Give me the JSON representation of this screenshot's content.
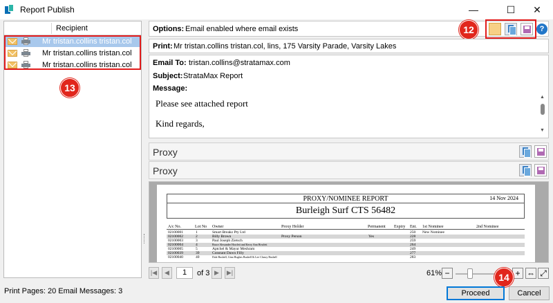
{
  "window": {
    "title": "Report Publish",
    "controls": {
      "minimize": "—",
      "maximize": "☐",
      "close": "✕"
    }
  },
  "recipients": {
    "column_header": "Recipient",
    "rows": [
      {
        "name": "Mr tristan.collins tristan.col",
        "selected": true
      },
      {
        "name": "Mr tristan.collins tristan.col",
        "selected": false
      },
      {
        "name": "Mr tristan.collins tristan.col",
        "selected": false
      }
    ]
  },
  "annotations": {
    "badge_12": "12",
    "badge_13": "13",
    "badge_14": "14"
  },
  "options": {
    "label": "Options:",
    "value": "Email enabled where email exists"
  },
  "print": {
    "label": "Print:",
    "value": "Mr tristan.collins tristan.col, lins, 175 Varsity Parade, Varsity Lakes"
  },
  "email": {
    "to_label": "Email To:",
    "to_value": "tristan.collins@stratamax.com",
    "subject_label": "Subject:",
    "subject_value": "StrataMax Report",
    "message_label": "Message:",
    "message_line1": "Please see attached report",
    "message_line2": "Kind regards,"
  },
  "proxy_rows": [
    {
      "label": "Proxy"
    },
    {
      "label": "Proxy"
    }
  ],
  "report": {
    "title": "PROXY/NOMINEE REPORT",
    "date": "14 Nov 2024",
    "subtitle": "Burleigh Surf CTS 56482",
    "columns": [
      "A/c No.",
      "Lot No",
      "Owner",
      "Proxy Holder",
      "Permanent",
      "Expiry",
      "Ent.",
      "1st Nominee",
      "2nd Nominee"
    ],
    "rows": [
      {
        "ac": "02100001",
        "lot": "1",
        "owner": "Smart Breakz Pty Ltd",
        "proxy": "",
        "perm": "",
        "ent": "250",
        "nominee1": "New Nominee"
      },
      {
        "ac": "02100002",
        "lot": "2",
        "owner": "Billy Brown",
        "proxy": "Proxy Person",
        "perm": "Yes",
        "ent": "228",
        "nominee1": ""
      },
      {
        "ac": "02100003",
        "lot": "3",
        "owner": "Paul Joseph Zietsch",
        "proxy": "",
        "perm": "",
        "ent": "259",
        "nominee1": ""
      },
      {
        "ac": "02100004",
        "lot": "4",
        "owner": "Bruce Alexander Howlett and Kerry Ann Howlett",
        "proxy": "",
        "perm": "",
        "ent": "264",
        "nominee1": ""
      },
      {
        "ac": "02100005",
        "lot": "5",
        "owner": "Aptchel & Mayur Meshram",
        "proxy": "",
        "perm": "",
        "ent": "249",
        "nominee1": ""
      },
      {
        "ac": "02100039",
        "lot": "39",
        "owner": "Constant Dawn Filly",
        "proxy": "",
        "perm": "",
        "ent": "277",
        "nominee1": ""
      },
      {
        "ac": "02100040",
        "lot": "40",
        "owner": "Dale Bushell, Gina Hughes Bushell & Lee Clancy Bushell",
        "proxy": "",
        "perm": "",
        "ent": "283",
        "nominee1": ""
      }
    ]
  },
  "navigation": {
    "current_page": "1",
    "of_pages": "of 3",
    "zoom": "61%"
  },
  "status": {
    "text": "Print Pages: 20  Email Messages: 3"
  },
  "buttons": {
    "proceed": "Proceed",
    "cancel": "Cancel"
  },
  "colors": {
    "accent_red": "#e1261c",
    "selection": "#a8c8ec",
    "primary_border": "#0078d7"
  }
}
